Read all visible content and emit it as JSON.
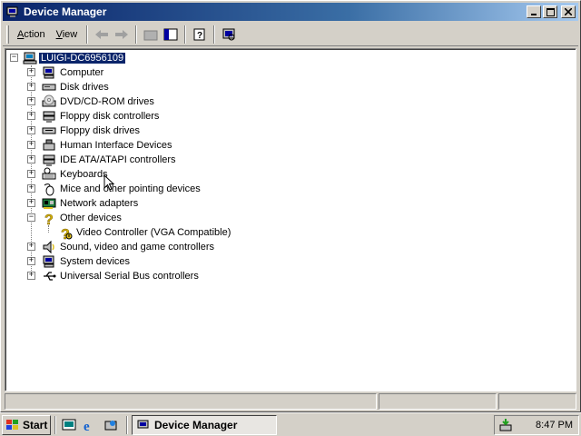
{
  "window": {
    "title": "Device Manager"
  },
  "menu": {
    "action_label": "Action",
    "view_label": "View"
  },
  "tree": {
    "root": "LUIGI-DC6956109",
    "categories": [
      {
        "label": "Computer",
        "icon": "computer-icon"
      },
      {
        "label": "Disk drives",
        "icon": "disk-drive-icon"
      },
      {
        "label": "DVD/CD-ROM drives",
        "icon": "cdrom-icon"
      },
      {
        "label": "Floppy disk controllers",
        "icon": "controller-icon"
      },
      {
        "label": "Floppy disk drives",
        "icon": "floppy-drive-icon"
      },
      {
        "label": "Human Interface Devices",
        "icon": "hid-icon"
      },
      {
        "label": "IDE ATA/ATAPI controllers",
        "icon": "ide-controller-icon"
      },
      {
        "label": "Keyboards",
        "icon": "keyboard-icon"
      },
      {
        "label": "Mice and other pointing devices",
        "icon": "mouse-icon"
      },
      {
        "label": "Network adapters",
        "icon": "network-adapter-icon"
      },
      {
        "label": "Other devices",
        "icon": "question-icon",
        "expanded": true
      },
      {
        "label": "Sound, video and game controllers",
        "icon": "sound-icon"
      },
      {
        "label": "System devices",
        "icon": "system-devices-icon"
      },
      {
        "label": "Universal Serial Bus controllers",
        "icon": "usb-icon"
      }
    ],
    "other_child": {
      "label": "Video Controller (VGA Compatible)",
      "icon": "warning-device-icon"
    }
  },
  "taskbar": {
    "start_label": "Start",
    "task_label": "Device Manager",
    "clock": "8:47 PM"
  }
}
